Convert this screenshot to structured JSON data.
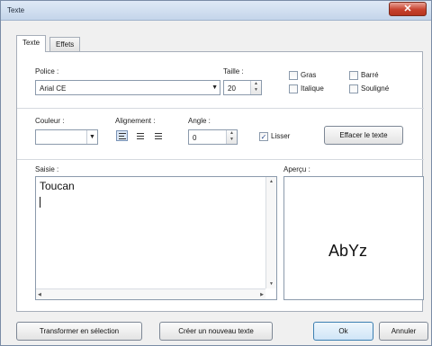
{
  "window": {
    "title": "Texte",
    "close_glyph": "✕"
  },
  "tabs": [
    {
      "label": "Texte"
    },
    {
      "label": "Effets"
    }
  ],
  "font": {
    "label": "Police :",
    "value": "Arial CE"
  },
  "size": {
    "label": "Taille :",
    "value": "20"
  },
  "styles": {
    "bold": "Gras",
    "strike": "Barré",
    "italic": "Italique",
    "underline": "Souligné"
  },
  "color": {
    "label": "Couleur :"
  },
  "alignment": {
    "label": "Alignement :",
    "selected": "left"
  },
  "angle": {
    "label": "Angle :",
    "value": "0"
  },
  "smooth": {
    "label": "Lisser",
    "checked": true
  },
  "clear_button": "Effacer le texte",
  "input": {
    "label": "Saisie :",
    "text": "Toucan"
  },
  "preview": {
    "label": "Aperçu :",
    "sample": "AbYz"
  },
  "buttons": {
    "to_selection": "Transformer en sélection",
    "new_text": "Créer un nouveau texte",
    "ok": "Ok",
    "cancel": "Annuler"
  },
  "icons": {
    "dropdown": "chevron-down-icon",
    "spin": "spin-arrows-icon",
    "close": "close-icon"
  }
}
